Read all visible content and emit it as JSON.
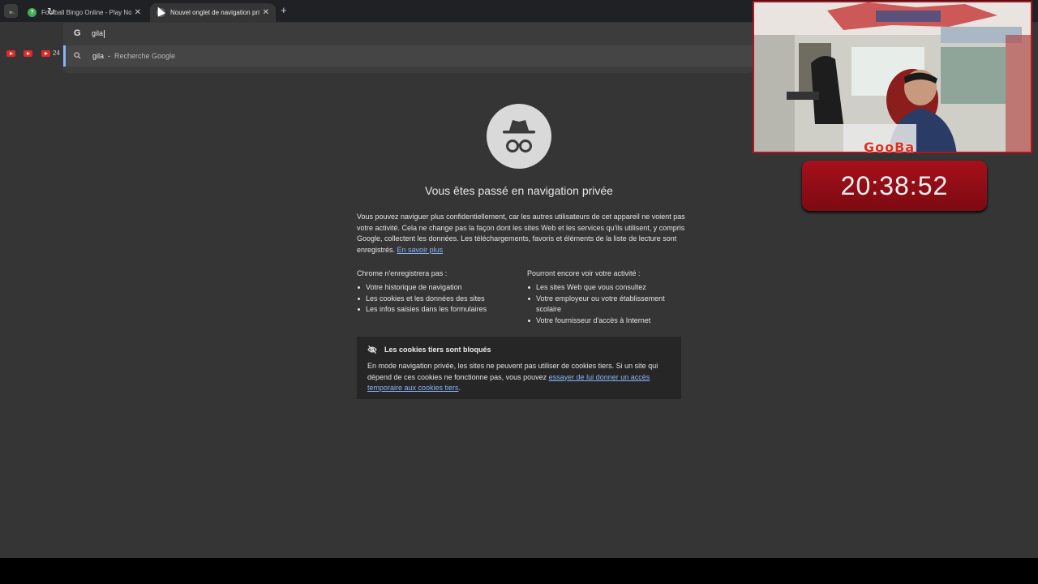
{
  "tabs": [
    {
      "title": "Football Bingo Online - Play Now",
      "favicon": "?"
    },
    {
      "title": "Nouvel onglet de navigation privée"
    }
  ],
  "omnibox": {
    "value": "gila",
    "suggestion_query": "gila",
    "suggestion_source": "Recherche Google"
  },
  "bookmarks": {
    "count_label": "24"
  },
  "incognito": {
    "heading": "Vous êtes passé en navigation privée",
    "intro": "Vous pouvez naviguer plus confidentiellement, car les autres utilisateurs de cet appareil ne voient pas votre activité. Cela ne change pas la façon dont les sites Web et les services qu'ils utilisent, y compris Google, collectent les données. Les téléchargements, favoris et éléments de la liste de lecture sont enregistrés.",
    "learn_more": "En savoir plus",
    "col1": {
      "title": "Chrome n'enregistrera pas :",
      "items": [
        "Votre historique de navigation",
        "Les cookies et les données des sites",
        "Les infos saisies dans les formulaires"
      ]
    },
    "col2": {
      "title": "Pourront encore voir votre activité :",
      "items": [
        "Les sites Web que vous consultez",
        "Votre employeur ou votre établissement scolaire",
        "Votre fournisseur d'accès à Internet"
      ]
    },
    "cookies": {
      "title": "Les cookies tiers sont bloqués",
      "body": "En mode navigation privée, les sites ne peuvent pas utiliser de cookies tiers. Si un site qui dépend de ces cookies ne fonctionne pas, vous pouvez ",
      "link": "essayer de lui donner un accès temporaire aux cookies tiers",
      "end": "."
    }
  },
  "stream": {
    "logo": "GooBa",
    "timer": "20:38:52"
  },
  "colors": {
    "page_bg": "#353535",
    "tabstrip_bg": "#202124",
    "link": "#8ab4f8",
    "timer_bg": "#a6101a"
  }
}
